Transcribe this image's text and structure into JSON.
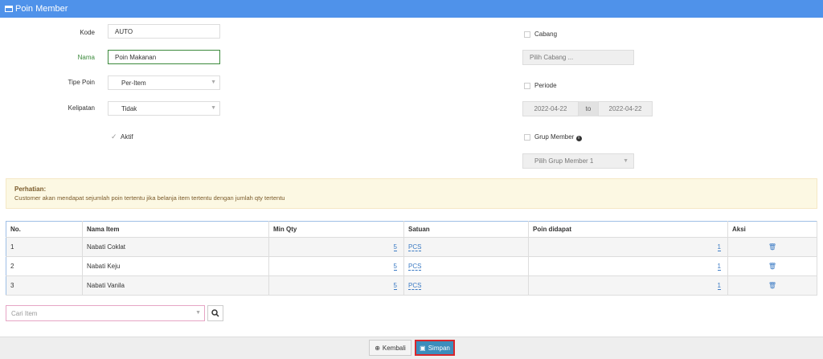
{
  "window": {
    "title": "Poin Member"
  },
  "form": {
    "kode": {
      "label": "Kode",
      "value": "AUTO"
    },
    "nama": {
      "label": "Nama",
      "value": "Poin Makanan"
    },
    "tipe_poin": {
      "label": "Tipe Poin",
      "value": "Per-Item"
    },
    "kelipatan": {
      "label": "Kelipatan",
      "value": "Tidak"
    },
    "aktif": {
      "label": "Aktif",
      "checked": true
    }
  },
  "options": {
    "cabang": {
      "label": "Cabang",
      "placeholder": "Pilih Cabang ..."
    },
    "periode": {
      "label": "Periode",
      "from": "2022-04-22",
      "sep": "to",
      "to": "2022-04-22"
    },
    "grup_member": {
      "label": "Grup Member",
      "value": "Pilih Grup Member 1"
    }
  },
  "alert": {
    "title": "Perhatian:",
    "message": "Customer akan mendapat sejumlah poin tertentu jika belanja item tertentu dengan jumlah qty tertentu"
  },
  "table": {
    "headers": [
      "No.",
      "Nama Item",
      "Min Qty",
      "Satuan",
      "Poin didapat",
      "Aksi"
    ],
    "rows": [
      {
        "no": "1",
        "item": "Nabati Coklat",
        "min_qty": "5",
        "satuan": "PCS",
        "poin": "1"
      },
      {
        "no": "2",
        "item": "Nabati Keju",
        "min_qty": "5",
        "satuan": "PCS",
        "poin": "1"
      },
      {
        "no": "3",
        "item": "Nabati Vanila",
        "min_qty": "5",
        "satuan": "PCS",
        "poin": "1"
      }
    ]
  },
  "search": {
    "placeholder": "Cari Item"
  },
  "buttons": {
    "back": "Kembali",
    "save": "Simpan"
  }
}
